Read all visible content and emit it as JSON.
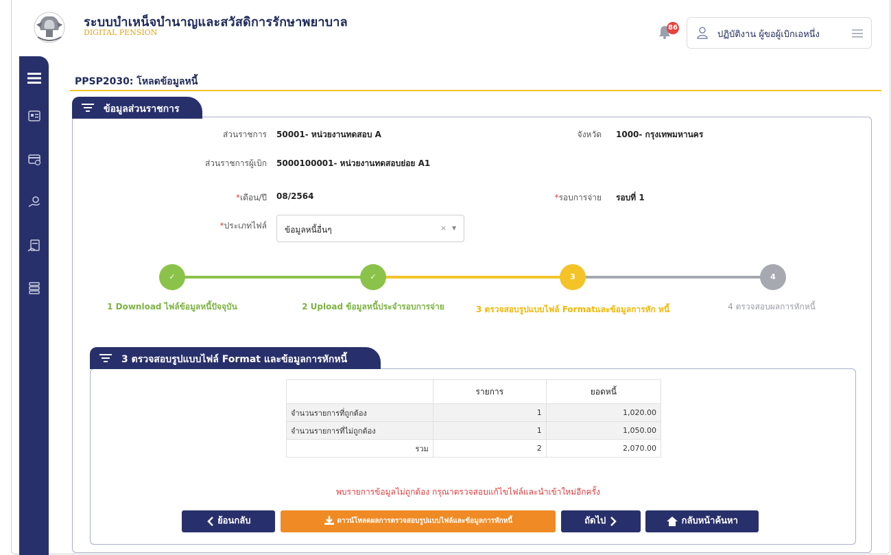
{
  "header": {
    "app_title": "ระบบบำเหน็จบำนาญและสวัสดิการรักษาพยาบาล",
    "app_subtitle": "DIGITAL PENSION",
    "notification_count": "86",
    "user_name": "ปฏิบัติงาน ผู้ขอผู้เบิกเอหนึ่ง"
  },
  "page": {
    "title": "PPSP2030: โหลดข้อมูลหนี้"
  },
  "section_info": {
    "title": "ข้อมูลส่วนราชการ",
    "agency_label": "ส่วนราชการ",
    "agency_value": "50001- หน่วยงานทดสอบ A",
    "province_label": "จังหวัด",
    "province_value": "1000- กรุงเทพมหานคร",
    "disbursing_label": "ส่วนราชการผู้เบิก",
    "disbursing_value": "5000100001- หน่วยงานทดสอบย่อย A1",
    "month_label": "เดือน/ปี",
    "month_value": "08/2564",
    "round_label": "รอบการจ่าย",
    "round_value": "รอบที่ 1",
    "filetype_label": "ประเภทไฟล์",
    "filetype_value": "ข้อมูลหนี้อื่นๆ",
    "required_mark": "*"
  },
  "steps": [
    {
      "num": "✓",
      "label": "1 Download ไฟล์ข้อมูลหนี้ปัจจุบัน",
      "state": "done"
    },
    {
      "num": "✓",
      "label": "2 Upload ข้อมูลหนี้ประจำรอบการจ่าย",
      "state": "done"
    },
    {
      "num": "3",
      "label": "3 ตรวจสอบรูปแบบไฟล์ Formatและข้อมูลการหัก หนี้",
      "state": "active"
    },
    {
      "num": "4",
      "label": "4 ตรวจสอบผลการหักหนี้",
      "state": "pending"
    }
  ],
  "colors": {
    "done": "#8bc34a",
    "active": "#f4c327",
    "pending": "#a6a9b0",
    "navy": "#28306b",
    "orange": "#f08a24"
  },
  "section_check": {
    "title": "3 ตรวจสอบรูปแบบไฟล์ Format และข้อมูลการหักหนี้",
    "col_items": "รายการ",
    "col_amount": "ยอดหนี้",
    "rows": [
      {
        "label": "จำนวนรายการที่ถูกต้อง",
        "items": "1",
        "amount": "1,020.00"
      },
      {
        "label": "จำนวนรายการที่ไม่ถูกต้อง",
        "items": "1",
        "amount": "1,050.00"
      },
      {
        "label": "รวม",
        "items": "2",
        "amount": "2,070.00"
      }
    ],
    "warning": "พบรายการข้อมูลไม่ถูกต้อง กรุณาตรวจสอบแก้ไขไฟล์และนำเข้าใหม่อีกครั้ง"
  },
  "buttons": {
    "back": "ย้อนกลับ",
    "download": "ดาวน์โหลดผลการตรวจสอบรูปแบบไฟล์และข้อมูลการหักหนี้",
    "next": "ถัดไป",
    "home": "กลับหน้าค้นหา"
  }
}
